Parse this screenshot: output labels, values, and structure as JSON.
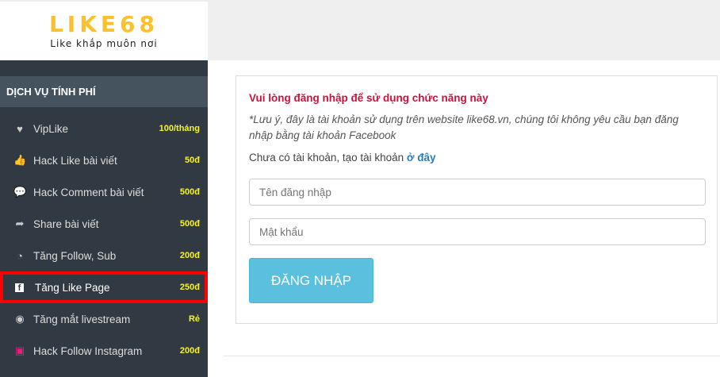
{
  "logo": {
    "brand": "LIKE68",
    "tagline": "Like khắp muôn nơi"
  },
  "sidebar": {
    "section_title": "DỊCH VỤ TÍNH PHÍ",
    "items": [
      {
        "label": "VipLike",
        "price": "100/tháng",
        "icon": "heart-icon",
        "glyph": "♥"
      },
      {
        "label": "Hack Like bài viết",
        "price": "50đ",
        "icon": "thumbs-up-icon",
        "glyph": "👍"
      },
      {
        "label": "Hack Comment bài viết",
        "price": "500đ",
        "icon": "comment-icon",
        "glyph": "💬"
      },
      {
        "label": "Share bài viết",
        "price": "500đ",
        "icon": "share-icon",
        "glyph": "➦"
      },
      {
        "label": "Tăng Follow, Sub",
        "price": "200đ",
        "icon": "rss-icon",
        "glyph": "◔"
      },
      {
        "label": "Tăng Like Page",
        "price": "250đ",
        "icon": "facebook-icon",
        "glyph": "f",
        "active": true
      },
      {
        "label": "Tăng mắt livestream",
        "price": "Rẻ",
        "icon": "eye-icon",
        "glyph": "◉"
      },
      {
        "label": "Hack Follow Instagram",
        "price": "200đ",
        "icon": "instagram-icon",
        "glyph": "▣"
      }
    ]
  },
  "login": {
    "warning": "Vui lòng đăng nhập để sử dụng chức năng này",
    "note": "*Lưu ý, đây là tài khoản sử dụng trên website like68.vn, chúng tôi không yêu cầu bạn đăng nhập bằng tài khoản Facebook",
    "register_text": "Chưa có tài khoản, tạo tài khoản ",
    "register_link": "ở đây",
    "username_placeholder": "Tên đăng nhập",
    "password_placeholder": "Mật khẩu",
    "submit": "ĐĂNG NHẬP"
  },
  "colors": {
    "highlight": "#ff0000",
    "price": "#f5f52a",
    "warning": "#d0103a",
    "button": "#5bc0de"
  }
}
